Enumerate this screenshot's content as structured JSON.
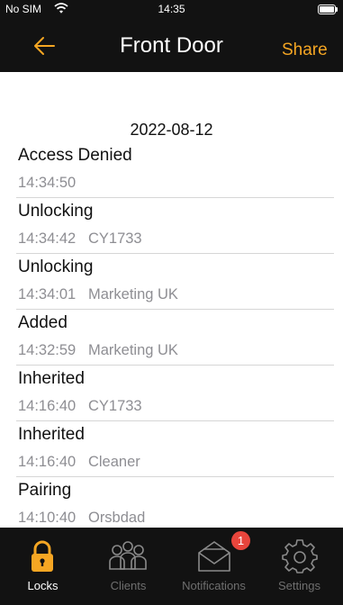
{
  "status_bar": {
    "carrier": "No SIM",
    "time": "14:35"
  },
  "nav": {
    "title": "Front Door",
    "share_label": "Share"
  },
  "log": {
    "date": "2022-08-12",
    "entries": [
      {
        "title": "Access Denied",
        "detail": "14:34:50"
      },
      {
        "title": "Unlocking",
        "detail": "14:34:42   CY1733"
      },
      {
        "title": "Unlocking",
        "detail": "14:34:01   Marketing UK"
      },
      {
        "title": "Added",
        "detail": "14:32:59   Marketing UK"
      },
      {
        "title": "Inherited",
        "detail": "14:16:40   CY1733"
      },
      {
        "title": "Inherited",
        "detail": "14:16:40   Cleaner"
      },
      {
        "title": "Pairing",
        "detail": "14:10:40   Orsbdad"
      }
    ]
  },
  "tabs": [
    {
      "label": "Locks",
      "icon": "lock-icon",
      "active": true
    },
    {
      "label": "Clients",
      "icon": "clients-icon",
      "active": false
    },
    {
      "label": "Notifications",
      "icon": "envelope-icon",
      "active": false,
      "badge": "1"
    },
    {
      "label": "Settings",
      "icon": "gear-icon",
      "active": false
    }
  ],
  "colors": {
    "accent": "#f5a623",
    "bar_bg": "#121212",
    "badge": "#e8453c"
  }
}
